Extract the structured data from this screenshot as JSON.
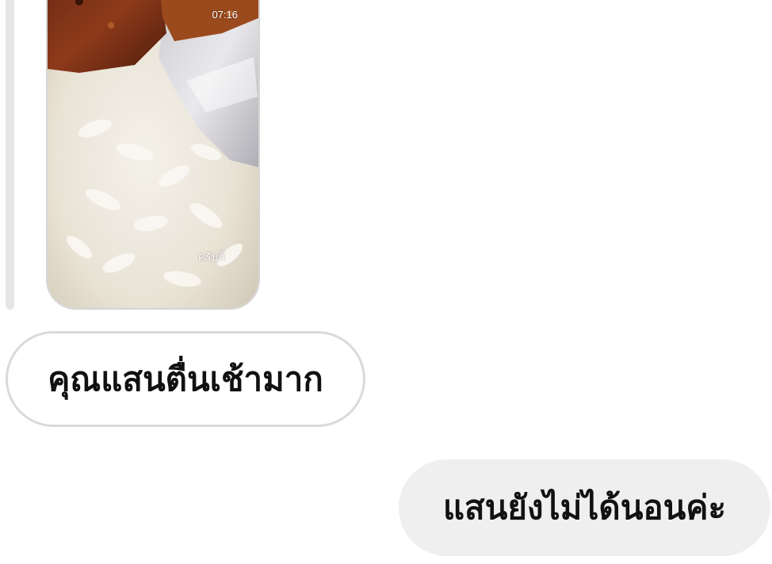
{
  "story_reply": {
    "timestamp": "07:16",
    "caption": "ครับก็",
    "photo_icon": "story-photo-sticky-rice"
  },
  "messages": [
    {
      "direction": "incoming",
      "text": "คุณแสนตื่นเช้ามาก"
    },
    {
      "direction": "outgoing",
      "text": "แสนยังไม่ได้นอนค่ะ"
    }
  ],
  "colors": {
    "background": "#ffffff",
    "incoming_bubble_border": "#dadada",
    "outgoing_bubble_bg": "#efefef",
    "reply_bar": "#e6e6e6",
    "text": "#111111"
  }
}
